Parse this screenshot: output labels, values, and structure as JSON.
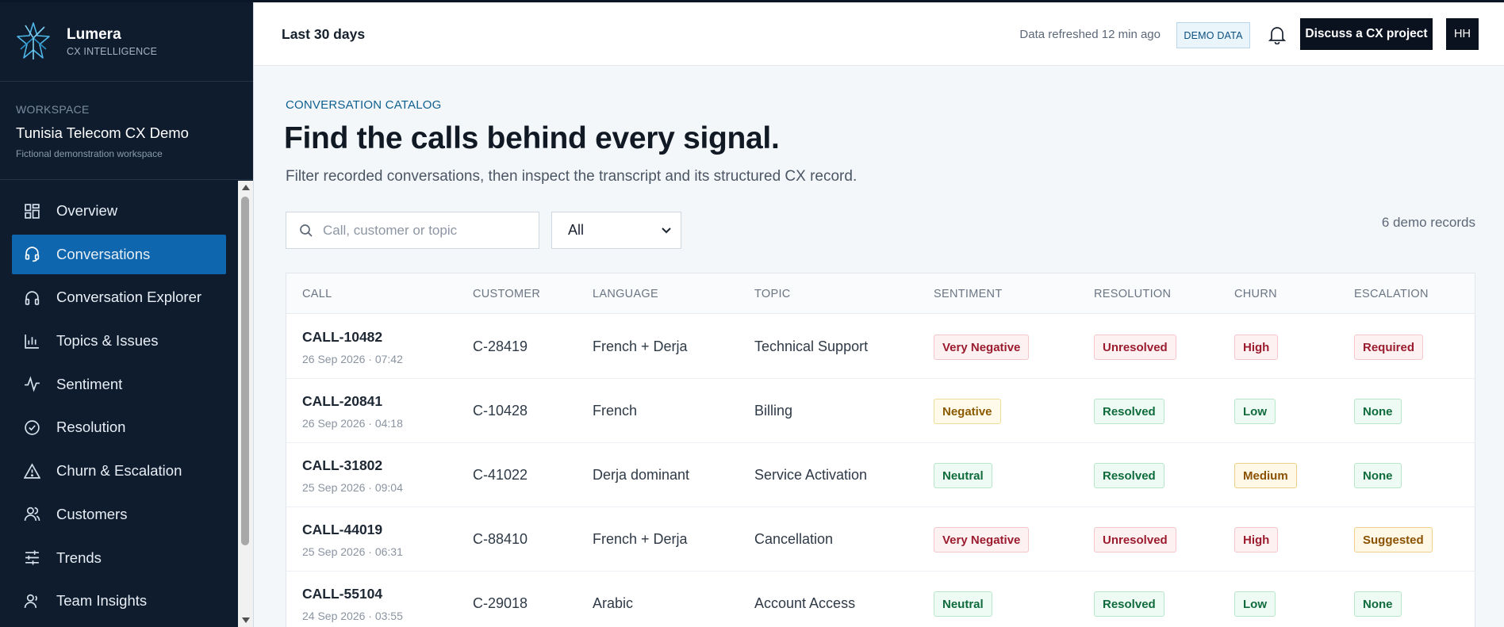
{
  "brand": {
    "name": "Lumera",
    "sub": "CX INTELLIGENCE"
  },
  "workspace": {
    "label": "WORKSPACE",
    "name": "Tunisia Telecom CX Demo",
    "sub": "Fictional demonstration workspace"
  },
  "nav": [
    {
      "label": "Overview",
      "icon": "grid-icon"
    },
    {
      "label": "Conversations",
      "icon": "headset-icon",
      "active": true
    },
    {
      "label": "Conversation Explorer",
      "icon": "headphones-icon"
    },
    {
      "label": "Topics & Issues",
      "icon": "bar-chart-icon"
    },
    {
      "label": "Sentiment",
      "icon": "pulse-icon"
    },
    {
      "label": "Resolution",
      "icon": "check-circle-icon"
    },
    {
      "label": "Churn & Escalation",
      "icon": "warning-icon"
    },
    {
      "label": "Customers",
      "icon": "users-icon"
    },
    {
      "label": "Trends",
      "icon": "sliders-icon"
    },
    {
      "label": "Team Insights",
      "icon": "team-icon"
    }
  ],
  "topbar": {
    "period": "Last 30 days",
    "refreshed": "Data refreshed 12 min ago",
    "demo_badge": "DEMO DATA",
    "cta": "Discuss a CX project",
    "avatar": "HH"
  },
  "main": {
    "eyebrow": "CONVERSATION CATALOG",
    "title": "Find the calls behind every signal.",
    "subtitle": "Filter recorded conversations, then inspect the transcript and its structured CX record.",
    "search_placeholder": "Call, customer or topic",
    "filter_value": "All",
    "records": "6 demo records"
  },
  "table": {
    "headers": [
      "CALL",
      "CUSTOMER",
      "LANGUAGE",
      "TOPIC",
      "SENTIMENT",
      "RESOLUTION",
      "CHURN",
      "ESCALATION"
    ],
    "rows": [
      {
        "call": "CALL-10482",
        "date": "26 Sep 2026 · 07:42",
        "customer": "C-28419",
        "language": "French + Derja",
        "topic": "Technical Support",
        "sentiment": "Very Negative",
        "resolution": "Unresolved",
        "churn": "High",
        "escalation": "Required"
      },
      {
        "call": "CALL-20841",
        "date": "26 Sep 2026 · 04:18",
        "customer": "C-10428",
        "language": "French",
        "topic": "Billing",
        "sentiment": "Negative",
        "resolution": "Resolved",
        "churn": "Low",
        "escalation": "None"
      },
      {
        "call": "CALL-31802",
        "date": "25 Sep 2026 · 09:04",
        "customer": "C-41022",
        "language": "Derja dominant",
        "topic": "Service Activation",
        "sentiment": "Neutral",
        "resolution": "Resolved",
        "churn": "Medium",
        "escalation": "None"
      },
      {
        "call": "CALL-44019",
        "date": "25 Sep 2026 · 06:31",
        "customer": "C-88410",
        "language": "French + Derja",
        "topic": "Cancellation",
        "sentiment": "Very Negative",
        "resolution": "Unresolved",
        "churn": "High",
        "escalation": "Suggested"
      },
      {
        "call": "CALL-55104",
        "date": "24 Sep 2026 · 03:55",
        "customer": "C-29018",
        "language": "Arabic",
        "topic": "Account Access",
        "sentiment": "Neutral",
        "resolution": "Resolved",
        "churn": "Low",
        "escalation": "None"
      }
    ]
  }
}
